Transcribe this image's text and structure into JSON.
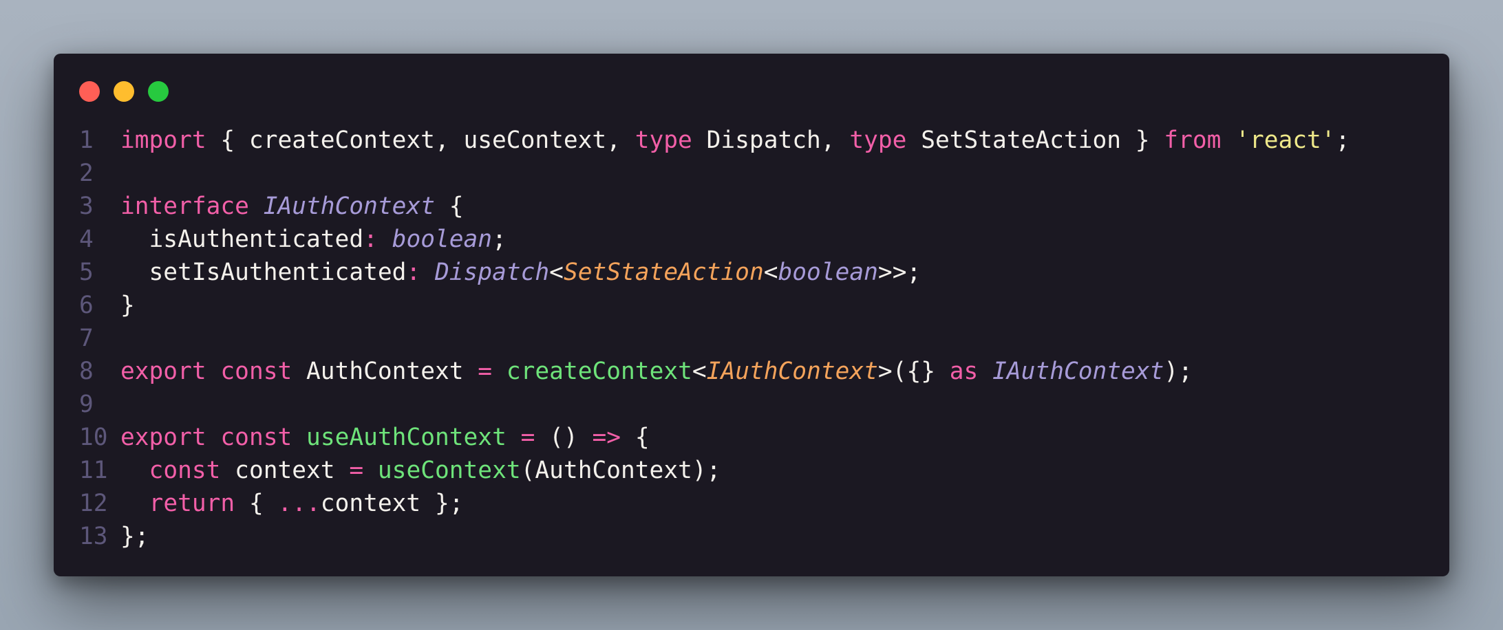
{
  "window_controls": {
    "close_color": "#ff5f56",
    "minimize_color": "#ffbd2e",
    "maximize_color": "#27c93f"
  },
  "code_lines": [
    {
      "number": "1",
      "tokens": [
        {
          "t": "import",
          "c": "kw"
        },
        {
          "t": " { createContext, useContext, ",
          "c": "src"
        },
        {
          "t": "type",
          "c": "kw"
        },
        {
          "t": " Dispatch, ",
          "c": "src"
        },
        {
          "t": "type",
          "c": "kw"
        },
        {
          "t": " SetStateAction } ",
          "c": "src"
        },
        {
          "t": "from",
          "c": "kw"
        },
        {
          "t": " ",
          "c": "src"
        },
        {
          "t": "'react'",
          "c": "str"
        },
        {
          "t": ";",
          "c": "src"
        }
      ]
    },
    {
      "number": "2",
      "tokens": []
    },
    {
      "number": "3",
      "tokens": [
        {
          "t": "interface",
          "c": "kw"
        },
        {
          "t": " ",
          "c": "src"
        },
        {
          "t": "IAuthContext",
          "c": "type-it"
        },
        {
          "t": " {",
          "c": "src"
        }
      ]
    },
    {
      "number": "4",
      "tokens": [
        {
          "t": "  isAuthenticated",
          "c": "src"
        },
        {
          "t": ":",
          "c": "kw"
        },
        {
          "t": " ",
          "c": "src"
        },
        {
          "t": "boolean",
          "c": "type-it"
        },
        {
          "t": ";",
          "c": "src"
        }
      ]
    },
    {
      "number": "5",
      "tokens": [
        {
          "t": "  setIsAuthenticated",
          "c": "src"
        },
        {
          "t": ":",
          "c": "kw"
        },
        {
          "t": " ",
          "c": "src"
        },
        {
          "t": "Dispatch",
          "c": "type-it"
        },
        {
          "t": "<",
          "c": "src"
        },
        {
          "t": "SetStateAction",
          "c": "type-or"
        },
        {
          "t": "<",
          "c": "src"
        },
        {
          "t": "boolean",
          "c": "type-it"
        },
        {
          "t": ">>;",
          "c": "src"
        }
      ]
    },
    {
      "number": "6",
      "tokens": [
        {
          "t": "}",
          "c": "src"
        }
      ]
    },
    {
      "number": "7",
      "tokens": []
    },
    {
      "number": "8",
      "tokens": [
        {
          "t": "export",
          "c": "kw"
        },
        {
          "t": " ",
          "c": "src"
        },
        {
          "t": "const",
          "c": "kw"
        },
        {
          "t": " AuthContext ",
          "c": "src"
        },
        {
          "t": "=",
          "c": "kw"
        },
        {
          "t": " ",
          "c": "src"
        },
        {
          "t": "createContext",
          "c": "fn"
        },
        {
          "t": "<",
          "c": "src"
        },
        {
          "t": "IAuthContext",
          "c": "type-or"
        },
        {
          "t": ">({} ",
          "c": "src"
        },
        {
          "t": "as",
          "c": "kw"
        },
        {
          "t": " ",
          "c": "src"
        },
        {
          "t": "IAuthContext",
          "c": "type-it"
        },
        {
          "t": ");",
          "c": "src"
        }
      ]
    },
    {
      "number": "9",
      "tokens": []
    },
    {
      "number": "10",
      "tokens": [
        {
          "t": "export",
          "c": "kw"
        },
        {
          "t": " ",
          "c": "src"
        },
        {
          "t": "const",
          "c": "kw"
        },
        {
          "t": " ",
          "c": "src"
        },
        {
          "t": "useAuthContext",
          "c": "fn"
        },
        {
          "t": " ",
          "c": "src"
        },
        {
          "t": "=",
          "c": "kw"
        },
        {
          "t": " () ",
          "c": "src"
        },
        {
          "t": "=>",
          "c": "kw"
        },
        {
          "t": " {",
          "c": "src"
        }
      ]
    },
    {
      "number": "11",
      "tokens": [
        {
          "t": "  ",
          "c": "src"
        },
        {
          "t": "const",
          "c": "kw"
        },
        {
          "t": " context ",
          "c": "src"
        },
        {
          "t": "=",
          "c": "kw"
        },
        {
          "t": " ",
          "c": "src"
        },
        {
          "t": "useContext",
          "c": "fn"
        },
        {
          "t": "(AuthContext);",
          "c": "src"
        }
      ]
    },
    {
      "number": "12",
      "tokens": [
        {
          "t": "  ",
          "c": "src"
        },
        {
          "t": "return",
          "c": "kw"
        },
        {
          "t": " { ",
          "c": "src"
        },
        {
          "t": "...",
          "c": "kw"
        },
        {
          "t": "context };",
          "c": "src"
        }
      ]
    },
    {
      "number": "13",
      "tokens": [
        {
          "t": "};",
          "c": "src"
        }
      ]
    }
  ]
}
